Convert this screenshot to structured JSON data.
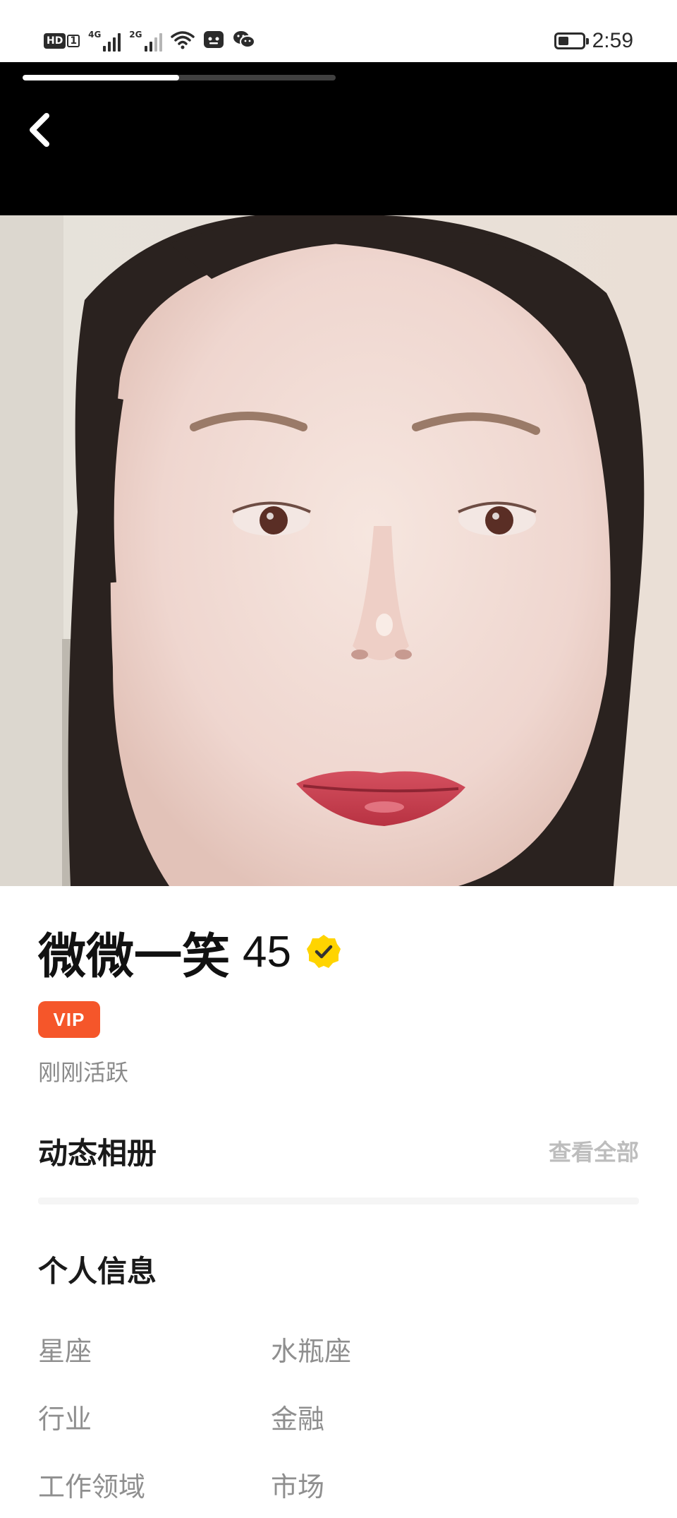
{
  "status_bar": {
    "hd_label": "HD",
    "sim_label": "1",
    "network_1": "4G",
    "network_2": "2G",
    "battery_level": 0.45,
    "time": "2:59",
    "icons": [
      "wifi-icon",
      "app-notification-icon",
      "wechat-icon"
    ]
  },
  "header": {
    "photo_progress": 0.5,
    "back_icon": "chevron-left-icon"
  },
  "profile": {
    "name": "微微一笑",
    "age": "45",
    "verified_icon": "verified-check-icon",
    "verified_color": "#ffd400",
    "vip_label": "VIP",
    "vip_color": "#f5562a",
    "activity": "刚刚活跃"
  },
  "album": {
    "title": "动态相册",
    "view_all": "查看全部"
  },
  "personal_info": {
    "title": "个人信息",
    "rows": [
      {
        "key": "星座",
        "value": "水瓶座"
      },
      {
        "key": "行业",
        "value": "金融"
      },
      {
        "key": "工作领域",
        "value": "市场"
      }
    ]
  }
}
